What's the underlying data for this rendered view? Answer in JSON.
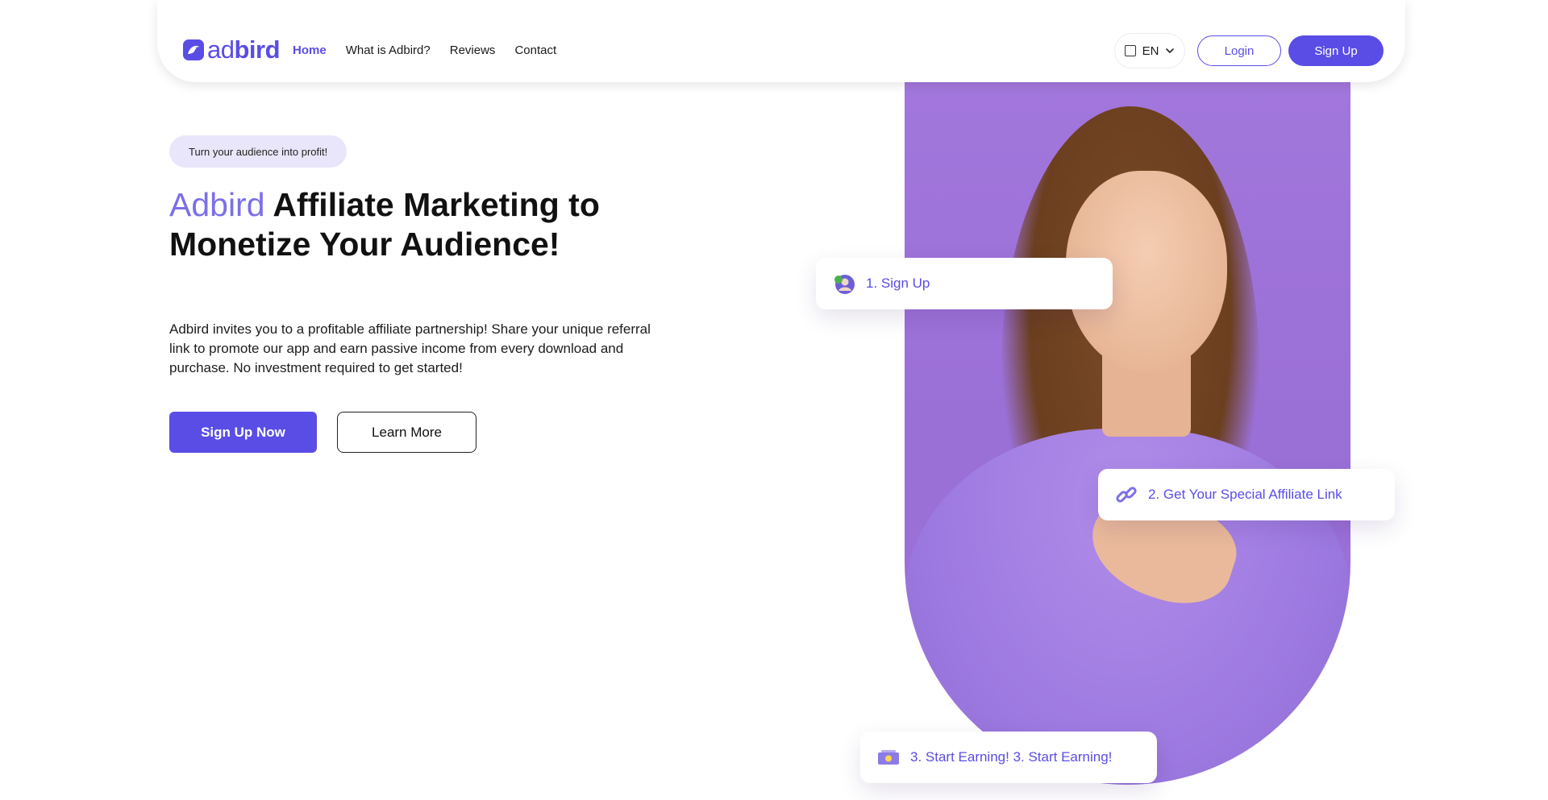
{
  "header": {
    "logo_text": {
      "regular": "ad",
      "bold": "bird"
    },
    "nav": [
      {
        "label": "Home",
        "active": true
      },
      {
        "label": "What is Adbird?",
        "active": false
      },
      {
        "label": "Reviews",
        "active": false
      },
      {
        "label": "Contact",
        "active": false
      }
    ],
    "language": "EN",
    "login_label": "Login",
    "signup_label": "Sign Up"
  },
  "hero": {
    "tagline": "Turn your audience into profit!",
    "headline": {
      "brand": "Adbird",
      "rest": " Affiliate Marketing to Monetize Your Audience!"
    },
    "description": "Adbird invites you to a profitable affiliate partnership! Share your unique referral link to promote our app and earn passive income from every download and purchase. No investment required to get started!",
    "primary_cta": "Sign Up Now",
    "secondary_cta": "Learn More"
  },
  "steps": [
    {
      "label": "1. Sign Up",
      "icon": "user-icon"
    },
    {
      "label": "2. Get Your Special Affiliate Link",
      "icon": "link-icon"
    },
    {
      "label": "3. Start Earning! 3. Start Earning!",
      "icon": "money-icon"
    }
  ],
  "colors": {
    "accent": "#5a4de6",
    "accent_light": "#7b6fe8",
    "pill_bg": "#e9e6fb",
    "photo_bg": "#a277dc"
  }
}
